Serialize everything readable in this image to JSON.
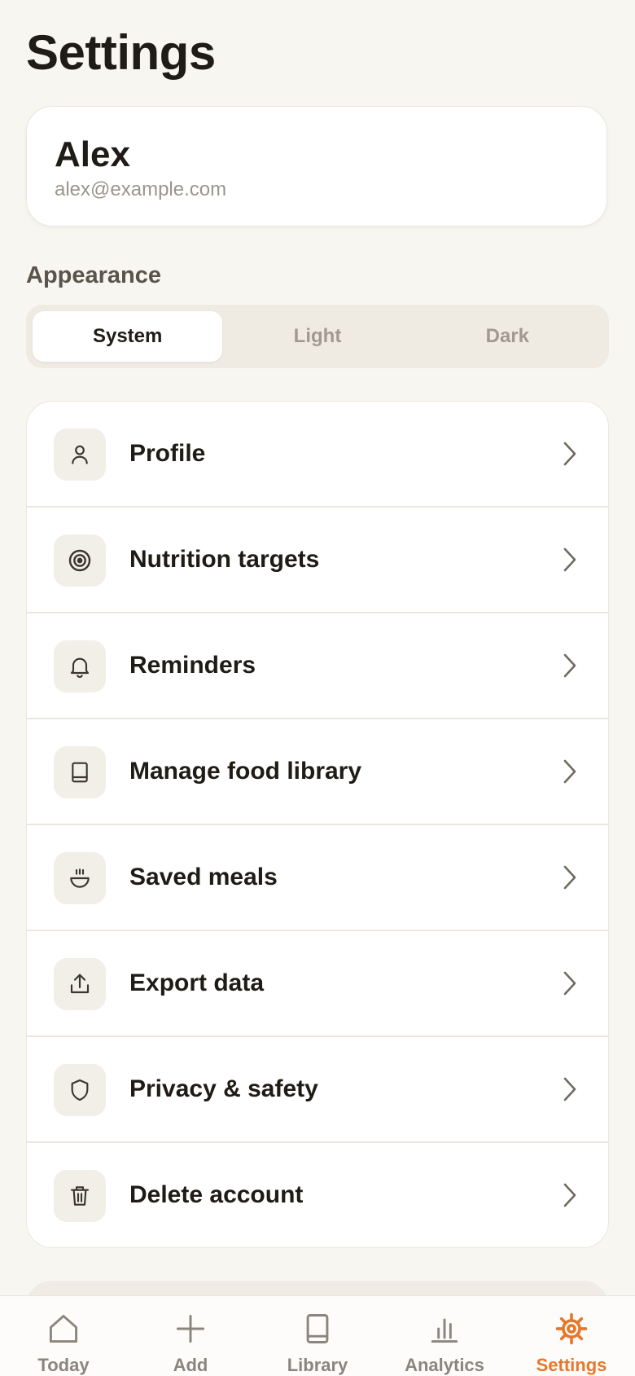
{
  "header": {
    "title": "Settings"
  },
  "profile": {
    "name": "Alex",
    "email": "alex@example.com"
  },
  "appearance": {
    "label": "Appearance",
    "options": [
      "System",
      "Light",
      "Dark"
    ],
    "selected": "System"
  },
  "menu": {
    "items": [
      {
        "label": "Profile",
        "icon": "person-icon"
      },
      {
        "label": "Nutrition targets",
        "icon": "target-icon"
      },
      {
        "label": "Reminders",
        "icon": "bell-icon"
      },
      {
        "label": "Manage food library",
        "icon": "book-icon"
      },
      {
        "label": "Saved meals",
        "icon": "bowl-icon"
      },
      {
        "label": "Export data",
        "icon": "export-icon"
      },
      {
        "label": "Privacy & safety",
        "icon": "shield-icon"
      },
      {
        "label": "Delete account",
        "icon": "trash-icon"
      }
    ]
  },
  "tabbar": {
    "tabs": [
      {
        "label": "Today",
        "icon": "home-icon"
      },
      {
        "label": "Add",
        "icon": "plus-icon"
      },
      {
        "label": "Library",
        "icon": "book-icon"
      },
      {
        "label": "Analytics",
        "icon": "bar-chart-icon"
      },
      {
        "label": "Settings",
        "icon": "gear-icon"
      }
    ],
    "active": "Settings"
  },
  "colors": {
    "accent": "#e4782c",
    "background": "#f8f6f1",
    "card": "#ffffff"
  }
}
